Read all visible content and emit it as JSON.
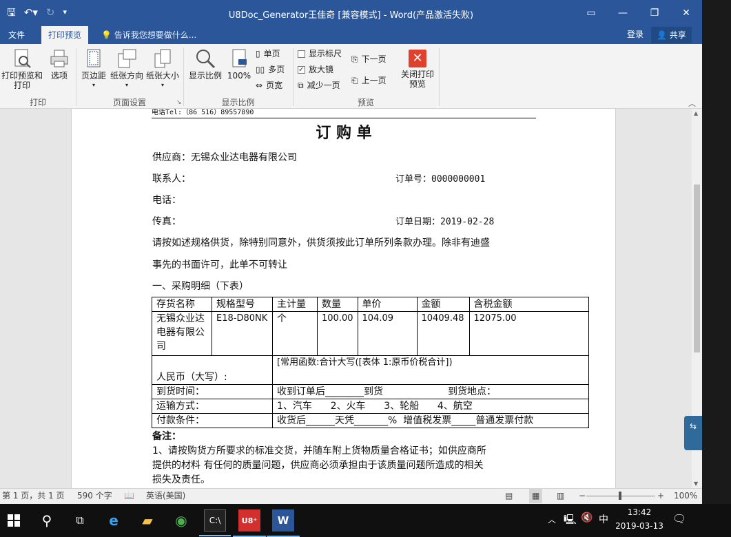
{
  "titlebar": {
    "title": "U8Doc_Generator王佳奇 [兼容模式] - Word(产品激活失败)",
    "save_icon": "save-icon",
    "undo_icon": "undo-icon",
    "redo_icon": "redo-icon"
  },
  "tabs": {
    "file": "文件",
    "print_preview": "打印预览",
    "tell_me": "告诉我您想要做什么...",
    "login": "登录",
    "share": "共享"
  },
  "ribbon": {
    "print_preview_and_print": "打印预览和打印",
    "options": "选项",
    "margins": "页边距",
    "orientation": "纸张方向",
    "size": "纸张大小",
    "zoom": "显示比例",
    "zoom_100": "100%",
    "one_page": "单页",
    "multi_page": "多页",
    "page_width": "页宽",
    "show_ruler": "显示标尺",
    "magnifier": "放大镜",
    "shrink_one_page": "减少一页",
    "next_page": "下一页",
    "prev_page": "上一页",
    "close_preview": "关闭打印预览",
    "groups": {
      "print": "打印",
      "page_setup": "页面设置",
      "zoom": "显示比例",
      "preview": "预览"
    }
  },
  "document": {
    "header_phone": "电话Tel:（86 516）89557890",
    "title": "订 购 单",
    "supplier": "供应商：无锡众业达电器有限公司",
    "contact": "联系人：",
    "order_no": "订单号：0000000001",
    "phone": "电话：",
    "fax": "传真：",
    "order_date": "订单日期：2019-02-28",
    "para1": "请按如述规格供货，除特别同意外，供货须按此订单所列条款办理。除非有迪盛",
    "para2": "事先的书面许可，此单不可转让",
    "section1": "一、采购明细（下表）",
    "table_headers": [
      "存货名称",
      "规格型号",
      "主计量",
      "数量",
      "单价",
      "金额",
      "含税金额"
    ],
    "table_rows": [
      [
        "无锡众业达电器有限公司",
        "E18-D80NK",
        "个",
        "100.00",
        "104.09",
        "10409.48",
        "12075.00"
      ]
    ],
    "rmb_label": "人民币（大写）:",
    "rmb_value": "[常用函数:合计大写([表体 1:原币价税合计])",
    "arrival_label": "到货时间：",
    "arrival_value": "收到订单后________到货",
    "arrival_place": "到货地点：",
    "transport_label": "运输方式：",
    "transport_value": "1、汽车      2、火车      3、轮船      4、航空",
    "payment_label": "付款条件：",
    "payment_value": "收货后______天凭_______%  增值税发票_____普通发票付款",
    "remark_label": "备注：",
    "remark1": "1、请按购货方所要求的标准交货，并随车附上货物质量合格证书；如供应商所",
    "remark2": "提供的材料 有任何的质量问题，供应商必须承担由于该质量问题所造成的相关",
    "remark3": "损失及责任。"
  },
  "status": {
    "page": "第 1 页，共 1 页",
    "words": "590 个字",
    "language": "英语(美国)",
    "zoom": "100%"
  },
  "taskbar": {
    "time": "13:42",
    "date": "2019-03-13",
    "ime": "中"
  }
}
